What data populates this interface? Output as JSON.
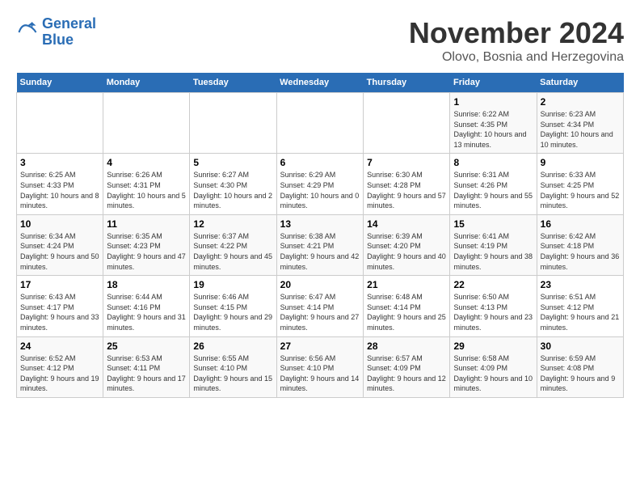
{
  "logo": {
    "line1": "General",
    "line2": "Blue"
  },
  "title": "November 2024",
  "location": "Olovo, Bosnia and Herzegovina",
  "weekdays": [
    "Sunday",
    "Monday",
    "Tuesday",
    "Wednesday",
    "Thursday",
    "Friday",
    "Saturday"
  ],
  "weeks": [
    [
      {
        "day": "",
        "info": ""
      },
      {
        "day": "",
        "info": ""
      },
      {
        "day": "",
        "info": ""
      },
      {
        "day": "",
        "info": ""
      },
      {
        "day": "",
        "info": ""
      },
      {
        "day": "1",
        "info": "Sunrise: 6:22 AM\nSunset: 4:35 PM\nDaylight: 10 hours and 13 minutes."
      },
      {
        "day": "2",
        "info": "Sunrise: 6:23 AM\nSunset: 4:34 PM\nDaylight: 10 hours and 10 minutes."
      }
    ],
    [
      {
        "day": "3",
        "info": "Sunrise: 6:25 AM\nSunset: 4:33 PM\nDaylight: 10 hours and 8 minutes."
      },
      {
        "day": "4",
        "info": "Sunrise: 6:26 AM\nSunset: 4:31 PM\nDaylight: 10 hours and 5 minutes."
      },
      {
        "day": "5",
        "info": "Sunrise: 6:27 AM\nSunset: 4:30 PM\nDaylight: 10 hours and 2 minutes."
      },
      {
        "day": "6",
        "info": "Sunrise: 6:29 AM\nSunset: 4:29 PM\nDaylight: 10 hours and 0 minutes."
      },
      {
        "day": "7",
        "info": "Sunrise: 6:30 AM\nSunset: 4:28 PM\nDaylight: 9 hours and 57 minutes."
      },
      {
        "day": "8",
        "info": "Sunrise: 6:31 AM\nSunset: 4:26 PM\nDaylight: 9 hours and 55 minutes."
      },
      {
        "day": "9",
        "info": "Sunrise: 6:33 AM\nSunset: 4:25 PM\nDaylight: 9 hours and 52 minutes."
      }
    ],
    [
      {
        "day": "10",
        "info": "Sunrise: 6:34 AM\nSunset: 4:24 PM\nDaylight: 9 hours and 50 minutes."
      },
      {
        "day": "11",
        "info": "Sunrise: 6:35 AM\nSunset: 4:23 PM\nDaylight: 9 hours and 47 minutes."
      },
      {
        "day": "12",
        "info": "Sunrise: 6:37 AM\nSunset: 4:22 PM\nDaylight: 9 hours and 45 minutes."
      },
      {
        "day": "13",
        "info": "Sunrise: 6:38 AM\nSunset: 4:21 PM\nDaylight: 9 hours and 42 minutes."
      },
      {
        "day": "14",
        "info": "Sunrise: 6:39 AM\nSunset: 4:20 PM\nDaylight: 9 hours and 40 minutes."
      },
      {
        "day": "15",
        "info": "Sunrise: 6:41 AM\nSunset: 4:19 PM\nDaylight: 9 hours and 38 minutes."
      },
      {
        "day": "16",
        "info": "Sunrise: 6:42 AM\nSunset: 4:18 PM\nDaylight: 9 hours and 36 minutes."
      }
    ],
    [
      {
        "day": "17",
        "info": "Sunrise: 6:43 AM\nSunset: 4:17 PM\nDaylight: 9 hours and 33 minutes."
      },
      {
        "day": "18",
        "info": "Sunrise: 6:44 AM\nSunset: 4:16 PM\nDaylight: 9 hours and 31 minutes."
      },
      {
        "day": "19",
        "info": "Sunrise: 6:46 AM\nSunset: 4:15 PM\nDaylight: 9 hours and 29 minutes."
      },
      {
        "day": "20",
        "info": "Sunrise: 6:47 AM\nSunset: 4:14 PM\nDaylight: 9 hours and 27 minutes."
      },
      {
        "day": "21",
        "info": "Sunrise: 6:48 AM\nSunset: 4:14 PM\nDaylight: 9 hours and 25 minutes."
      },
      {
        "day": "22",
        "info": "Sunrise: 6:50 AM\nSunset: 4:13 PM\nDaylight: 9 hours and 23 minutes."
      },
      {
        "day": "23",
        "info": "Sunrise: 6:51 AM\nSunset: 4:12 PM\nDaylight: 9 hours and 21 minutes."
      }
    ],
    [
      {
        "day": "24",
        "info": "Sunrise: 6:52 AM\nSunset: 4:12 PM\nDaylight: 9 hours and 19 minutes."
      },
      {
        "day": "25",
        "info": "Sunrise: 6:53 AM\nSunset: 4:11 PM\nDaylight: 9 hours and 17 minutes."
      },
      {
        "day": "26",
        "info": "Sunrise: 6:55 AM\nSunset: 4:10 PM\nDaylight: 9 hours and 15 minutes."
      },
      {
        "day": "27",
        "info": "Sunrise: 6:56 AM\nSunset: 4:10 PM\nDaylight: 9 hours and 14 minutes."
      },
      {
        "day": "28",
        "info": "Sunrise: 6:57 AM\nSunset: 4:09 PM\nDaylight: 9 hours and 12 minutes."
      },
      {
        "day": "29",
        "info": "Sunrise: 6:58 AM\nSunset: 4:09 PM\nDaylight: 9 hours and 10 minutes."
      },
      {
        "day": "30",
        "info": "Sunrise: 6:59 AM\nSunset: 4:08 PM\nDaylight: 9 hours and 9 minutes."
      }
    ]
  ]
}
